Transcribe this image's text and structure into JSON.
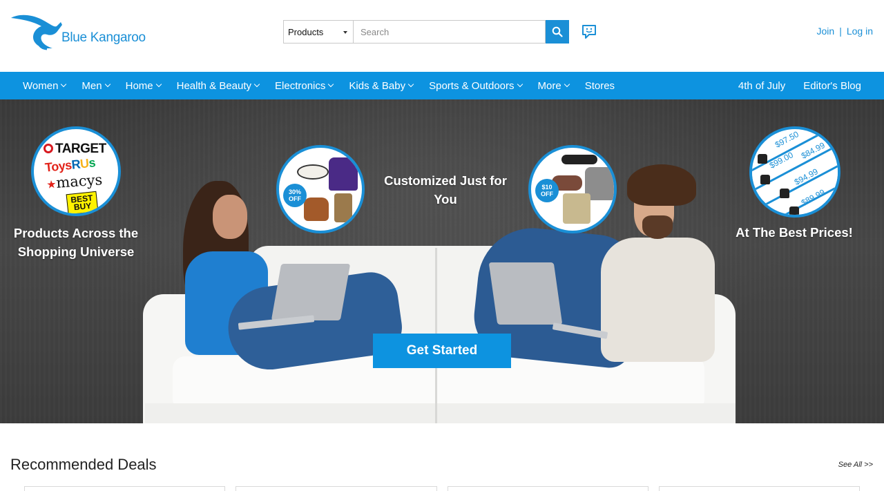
{
  "header": {
    "logo_text": "Blue Kangaroo",
    "search": {
      "category": "Products",
      "placeholder": "Search"
    },
    "auth": {
      "join": "Join",
      "separator": "|",
      "login": "Log in"
    }
  },
  "nav": {
    "items": [
      {
        "label": "Women",
        "dropdown": true
      },
      {
        "label": "Men",
        "dropdown": true
      },
      {
        "label": "Home",
        "dropdown": true
      },
      {
        "label": "Health & Beauty",
        "dropdown": true
      },
      {
        "label": "Electronics",
        "dropdown": true
      },
      {
        "label": "Kids & Baby",
        "dropdown": true
      },
      {
        "label": "Sports & Outdoors",
        "dropdown": true
      },
      {
        "label": "More",
        "dropdown": true
      },
      {
        "label": "Stores",
        "dropdown": false
      }
    ],
    "right_items": [
      {
        "label": "4th of July"
      },
      {
        "label": "Editor's Blog"
      }
    ]
  },
  "hero": {
    "caption_left": "Products Across the Shopping Universe",
    "caption_center": "Customized Just for You",
    "caption_right": "At The Best Prices!",
    "brands": {
      "target": "TARGET",
      "toys": [
        "Toys",
        "R",
        "U",
        "s"
      ],
      "macys": "macys",
      "bestbuy_line1": "BEST",
      "bestbuy_line2": "BUY"
    },
    "badge_discount": "30% OFF",
    "badge_discount_line1": "30%",
    "badge_discount_line2": "OFF",
    "badge_dollar_line1": "$10",
    "badge_dollar_line2": "OFF",
    "prices": [
      "$97.50",
      "$99.00",
      "$84.99",
      "$94.99",
      "$89.99"
    ],
    "cta": "Get Started"
  },
  "recommended": {
    "title": "Recommended Deals",
    "see_all": "See All >>"
  },
  "colors": {
    "brand_blue": "#1a8fd6",
    "nav_blue": "#0d93e0"
  }
}
